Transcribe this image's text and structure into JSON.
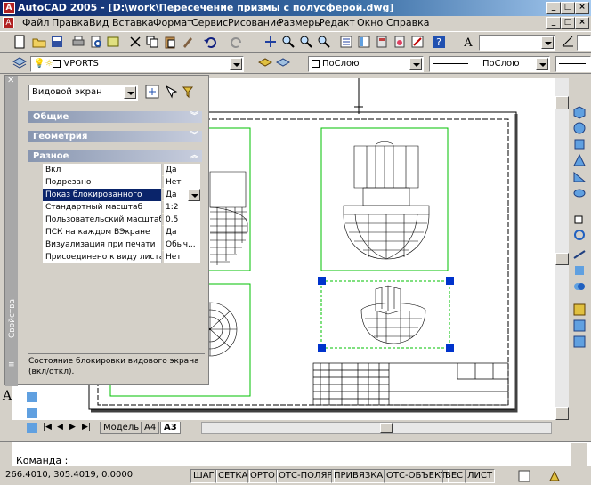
{
  "window": {
    "title": "AutoCAD 2005 - [D:\\work\\Пересечение призмы с полусферой.dwg]"
  },
  "menu": [
    "Файл",
    "Правка",
    "Вид",
    "Вставка",
    "Формат",
    "Сервис",
    "Рисование",
    "Размеры",
    "Редакт",
    "Окно",
    "Справка"
  ],
  "layers": {
    "current_layer": "VPORTS",
    "color_value": "ПоСлою",
    "linetype_value": "ПоСлою"
  },
  "properties": {
    "object_type": "Видовой экран",
    "palette_label": "Свойства",
    "sections": {
      "general": "Общие",
      "geometry": "Геометрия",
      "misc": "Разное"
    },
    "rows": [
      {
        "key": "Вкл",
        "value": "Да"
      },
      {
        "key": "Подрезано",
        "value": "Нет"
      },
      {
        "key": "Показ блокированного",
        "value": "Да"
      },
      {
        "key": "Стандартный масштаб",
        "value": "1:2"
      },
      {
        "key": "Пользовательский масштаб",
        "value": "0.5"
      },
      {
        "key": "ПСК на каждом ВЭкране",
        "value": "Да"
      },
      {
        "key": "Визуализация при печати",
        "value": "Обыч..."
      },
      {
        "key": "Присоединено к виду листа",
        "value": "Нет"
      }
    ],
    "description": "Состояние блокировки видового экрана (вкл/откл)."
  },
  "tabs": [
    "Модель",
    "A4",
    "A3"
  ],
  "command": {
    "prompt": "Команда :"
  },
  "status": {
    "coords": "266.4010, 305.4019, 0.0000",
    "toggles": [
      "ШАГ",
      "СЕТКА",
      "ОРТО",
      "ОТС-ПОЛЯР",
      "ПРИВЯЗКА",
      "ОТС-ОБЪЕКТ",
      "ВЕС",
      "ЛИСТ"
    ]
  },
  "colors": {
    "title_start": "#0a246a",
    "selection": "#0a246a",
    "viewport_border": "#00c000",
    "grip": "#0033cc"
  }
}
